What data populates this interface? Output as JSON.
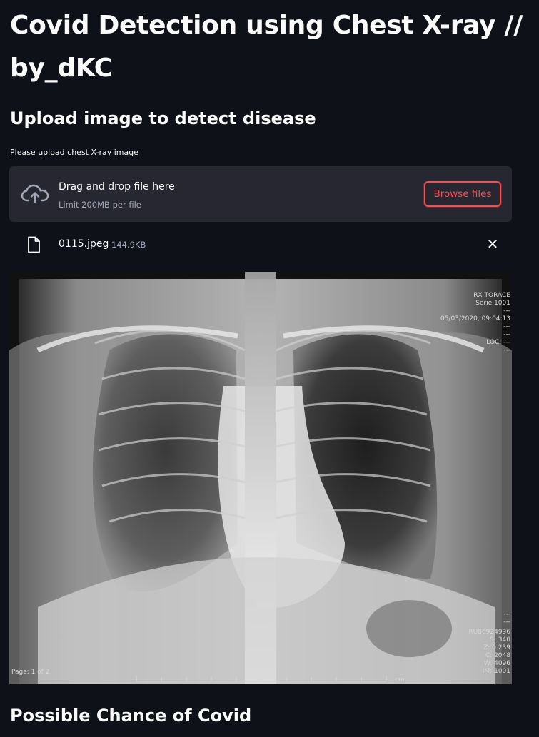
{
  "app": {
    "title": "Covid Detection using Chest X-ray // by_dKC",
    "subheader": "Upload image to detect disease"
  },
  "uploader": {
    "label": "Please upload chest X-ray image",
    "drag_text": "Drag and drop file here",
    "limit_text": "Limit 200MB per file",
    "browse_label": "Browse files",
    "icon": "cloud-upload-icon"
  },
  "uploaded_file": {
    "name": "0115.jpeg",
    "size": "144.9KB",
    "icon": "file-icon",
    "remove_icon": "close-icon",
    "remove_glyph": "✕"
  },
  "xray_overlay": {
    "top_right": [
      "RX TORACE",
      "Serie 1001",
      "---",
      "05/03/2020, 09:04:13",
      "---",
      "---",
      "LOC: ---",
      "---"
    ],
    "bottom_right": [
      "---",
      "---",
      "RU86924996",
      "S: 340",
      "Z: 0.239",
      "C: 2048",
      "W: 4096",
      "IM: 1001"
    ],
    "page_label": "Page: 1 of 2",
    "scale_unit": "cm"
  },
  "results": {
    "heading": "Possible Chance of Covid"
  },
  "colors": {
    "background": "#0e1117",
    "card": "#262730",
    "accent": "#ff4b4b",
    "text": "#fafafa",
    "muted": "#a3a8b8"
  }
}
